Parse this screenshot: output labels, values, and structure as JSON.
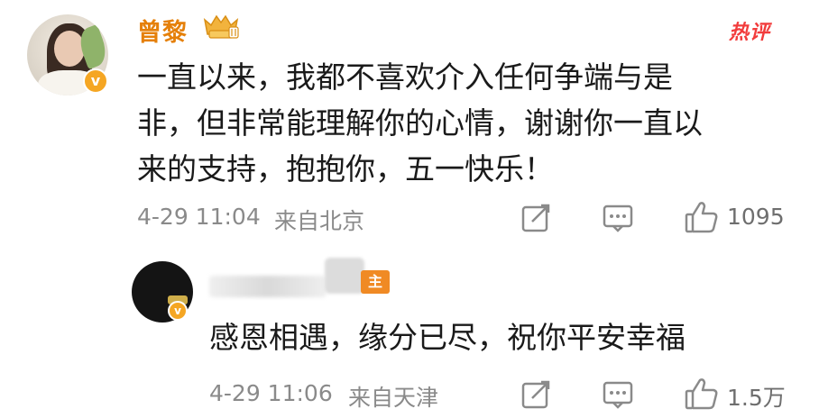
{
  "comment": {
    "username": "曾黎",
    "hot_tag": "热评",
    "verify_mark": "v",
    "lines": [
      "一直以来，我都不喜欢介入任何争端与是",
      "非，但非常能理解你的心情，谢谢你一直以",
      "来的支持，抱抱你，五一快乐！"
    ],
    "time": "4-29 11:04",
    "location": "来自北京",
    "likes": "1095",
    "icons": {
      "share": "share-icon",
      "comment": "comment-icon",
      "like": "thumbs-up-icon"
    }
  },
  "reply": {
    "badge": "主",
    "verify_mark": "v",
    "text": "感恩相遇，缘分已尽，祝你平安幸福",
    "time": "4-29 11:06",
    "location": "来自天津",
    "likes": "1.5万",
    "icons": {
      "share": "share-icon",
      "comment": "comment-icon",
      "like": "thumbs-up-icon"
    }
  },
  "colors": {
    "username": "#e5800a",
    "hot_tag": "#f23c3c",
    "verify": "#f5a623",
    "meta": "#8a8a8a"
  }
}
